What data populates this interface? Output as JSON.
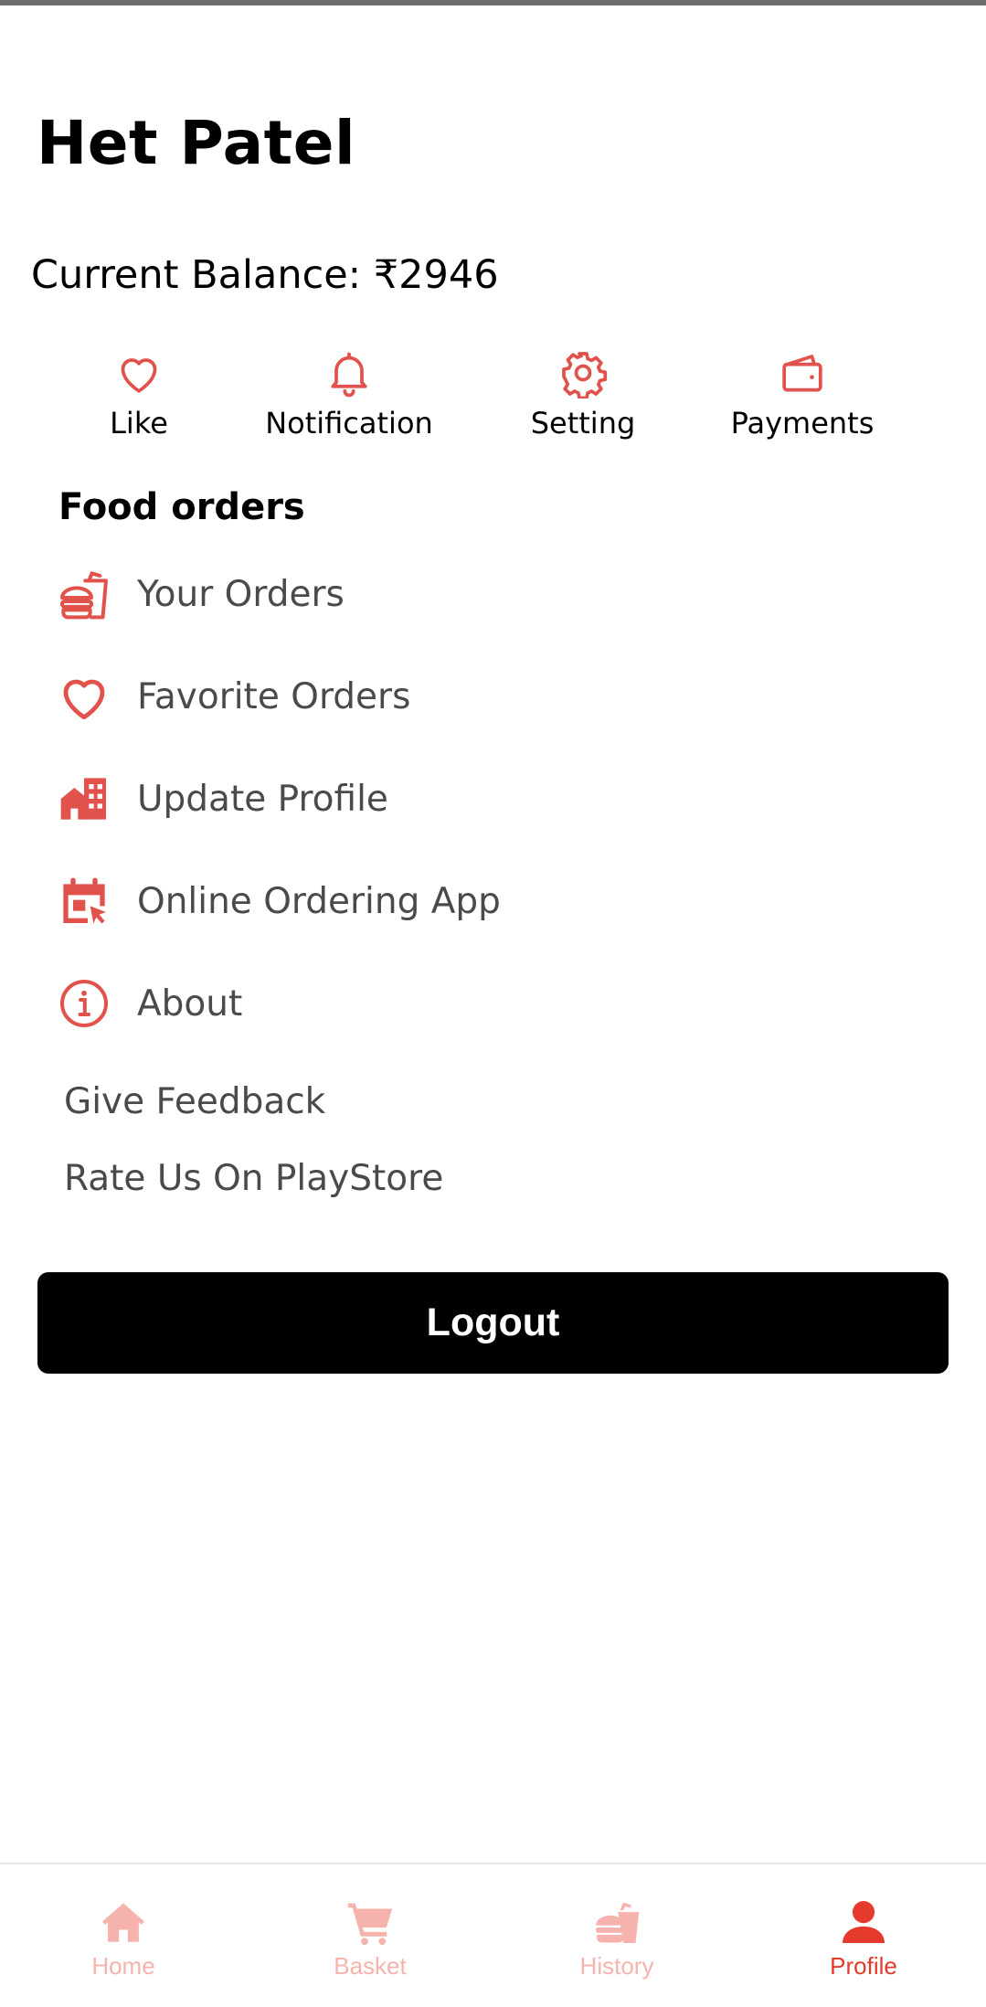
{
  "profile": {
    "name": "Het Patel",
    "balance_text": "Current Balance: ₹2946"
  },
  "quick_actions": [
    {
      "label": "Like",
      "icon": "heart-icon"
    },
    {
      "label": "Notification",
      "icon": "bell-icon"
    },
    {
      "label": "Setting",
      "icon": "gear-icon"
    },
    {
      "label": "Payments",
      "icon": "wallet-icon"
    }
  ],
  "food_orders": {
    "title": "Food orders",
    "items": [
      {
        "label": "Your Orders",
        "icon": "food-bag-icon"
      },
      {
        "label": "Favorite Orders",
        "icon": "heart-icon"
      },
      {
        "label": "Update Profile",
        "icon": "buildings-icon"
      },
      {
        "label": "Online Ordering App",
        "icon": "calendar-cursor-icon"
      },
      {
        "label": "About",
        "icon": "info-icon"
      }
    ]
  },
  "links": {
    "feedback": "Give Feedback",
    "rate": "Rate Us On PlayStore"
  },
  "logout_label": "Logout",
  "bottom_nav": [
    {
      "label": "Home",
      "icon": "home-icon",
      "active": false
    },
    {
      "label": "Basket",
      "icon": "cart-icon",
      "active": false
    },
    {
      "label": "History",
      "icon": "food-history-icon",
      "active": false
    },
    {
      "label": "Profile",
      "icon": "person-icon",
      "active": true
    }
  ],
  "colors": {
    "accent": "#e2524c",
    "nav_active": "#e53a2b",
    "nav_inactive": "#f6b3ae",
    "button_bg": "#000000"
  }
}
